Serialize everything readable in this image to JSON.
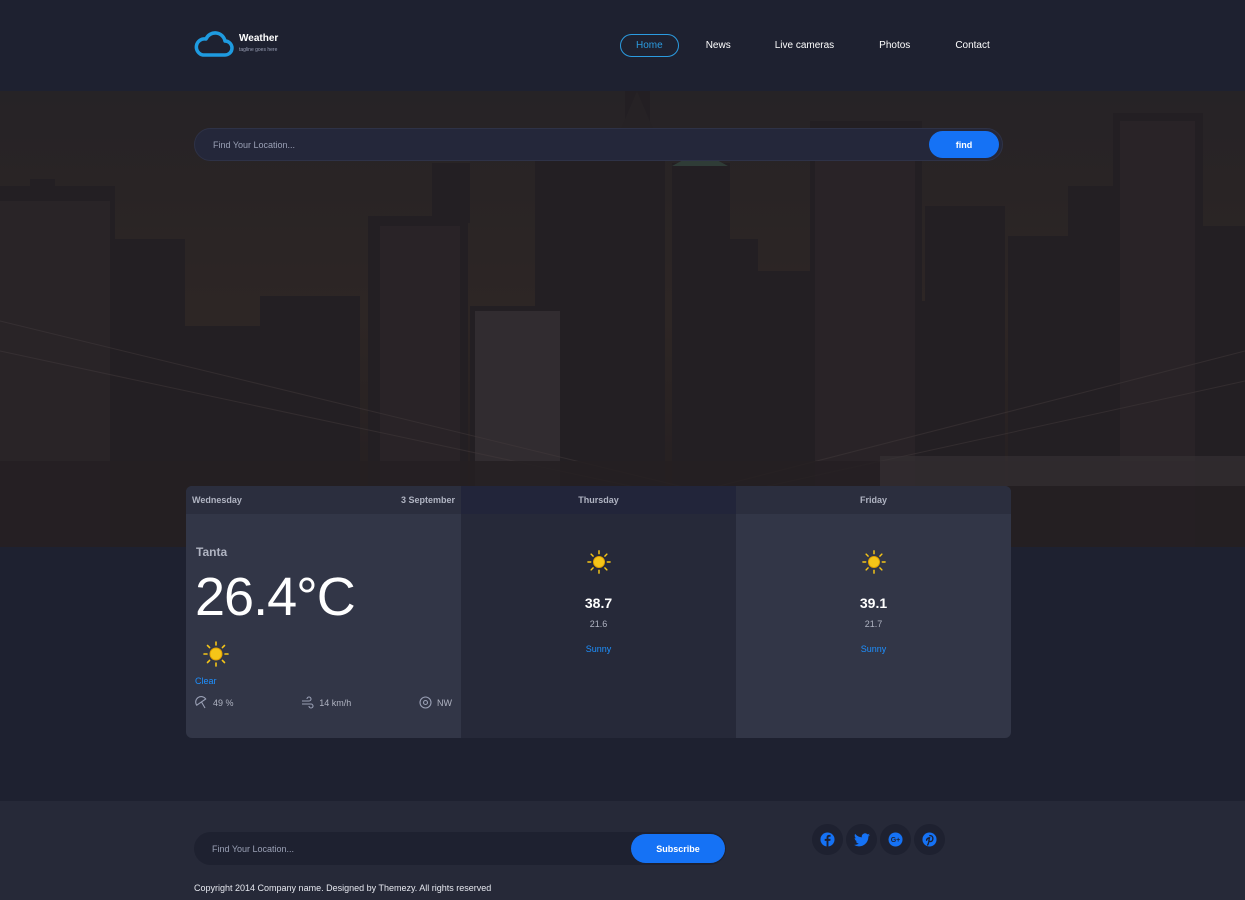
{
  "brand": {
    "title": "Weather",
    "tagline": "tagline goes here"
  },
  "nav": [
    {
      "label": "Home",
      "active": true
    },
    {
      "label": "News"
    },
    {
      "label": "Live cameras"
    },
    {
      "label": "Photos"
    },
    {
      "label": "Contact"
    }
  ],
  "search": {
    "placeholder": "Find Your Location...",
    "button": "find"
  },
  "forecast": {
    "today": {
      "day": "Wednesday",
      "date": "3 September",
      "city": "Tanta",
      "temperature": "26.4°C",
      "condition": "Clear",
      "humidity": "49 %",
      "wind_speed": "14 km/h",
      "wind_direction": "NW",
      "icon": "sun-icon"
    },
    "days": [
      {
        "day": "Thursday",
        "high": "38.7",
        "low": "21.6",
        "condition": "Sunny",
        "icon": "sun-icon"
      },
      {
        "day": "Friday",
        "high": "39.1",
        "low": "21.7",
        "condition": "Sunny",
        "icon": "sun-icon"
      }
    ]
  },
  "footer": {
    "subscribe_placeholder": "Find Your Location...",
    "subscribe_button": "Subscribe",
    "social": [
      "facebook-icon",
      "twitter-icon",
      "google-plus-icon",
      "pinterest-icon"
    ],
    "copyright": "Copyright 2014 Company name. Designed by Themezy. All rights reserved"
  },
  "colors": {
    "accent": "#1572f5",
    "nav_active": "#2b9be0",
    "background": "#1e2130",
    "sun": "#f5c518"
  }
}
